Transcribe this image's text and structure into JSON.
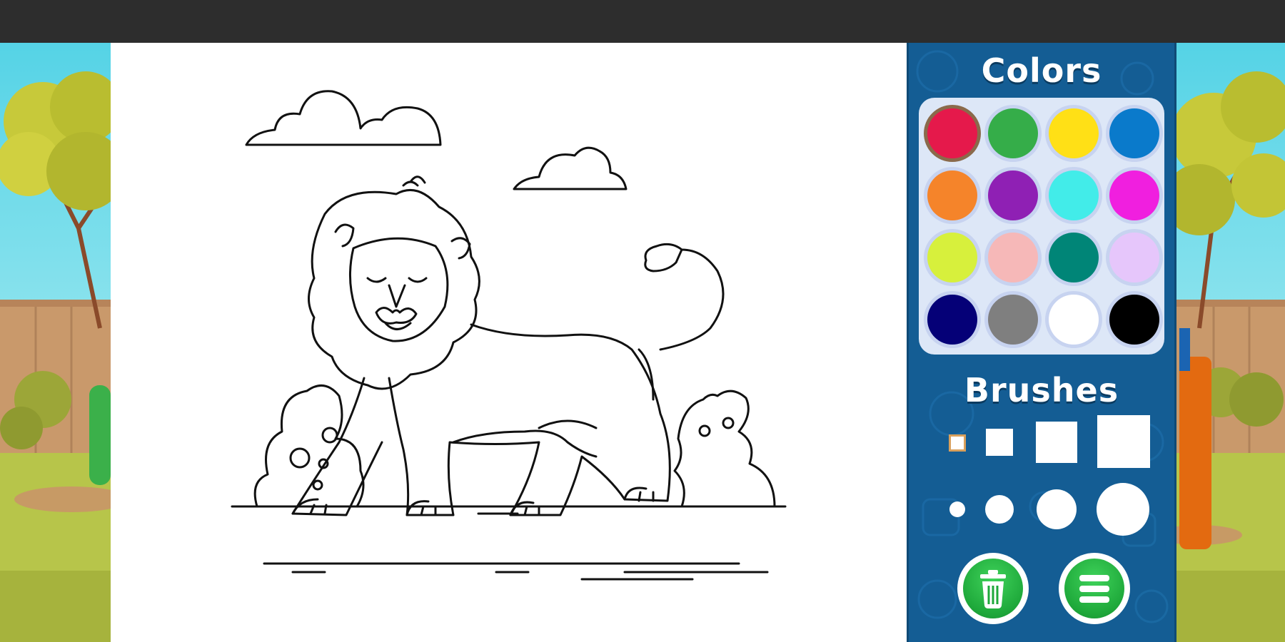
{
  "panel": {
    "colors_title": "Colors",
    "brushes_title": "Brushes"
  },
  "palette": {
    "selected_index": 0,
    "colors": [
      "#e5194b",
      "#35ad49",
      "#ffe016",
      "#0a7acb",
      "#f5842a",
      "#8f20b4",
      "#42ece9",
      "#f01fdf",
      "#d7f03c",
      "#f6b8b8",
      "#008577",
      "#e6c6fb",
      "#050077",
      "#7f7f7f",
      "#ffffff",
      "#000000"
    ]
  },
  "brushes": {
    "square_sizes": [
      "tiny",
      "small",
      "medium",
      "large"
    ],
    "circle_sizes": [
      "tiny",
      "small",
      "medium",
      "large"
    ]
  },
  "buttons": {
    "clear_icon": "trash-icon",
    "menu_icon": "menu-icon"
  },
  "colors_theme": {
    "panel_bg": "#145d94",
    "button_green": "#1ea83a",
    "canvas_bg": "#ffffff",
    "topbar": "#2d2d2d"
  }
}
